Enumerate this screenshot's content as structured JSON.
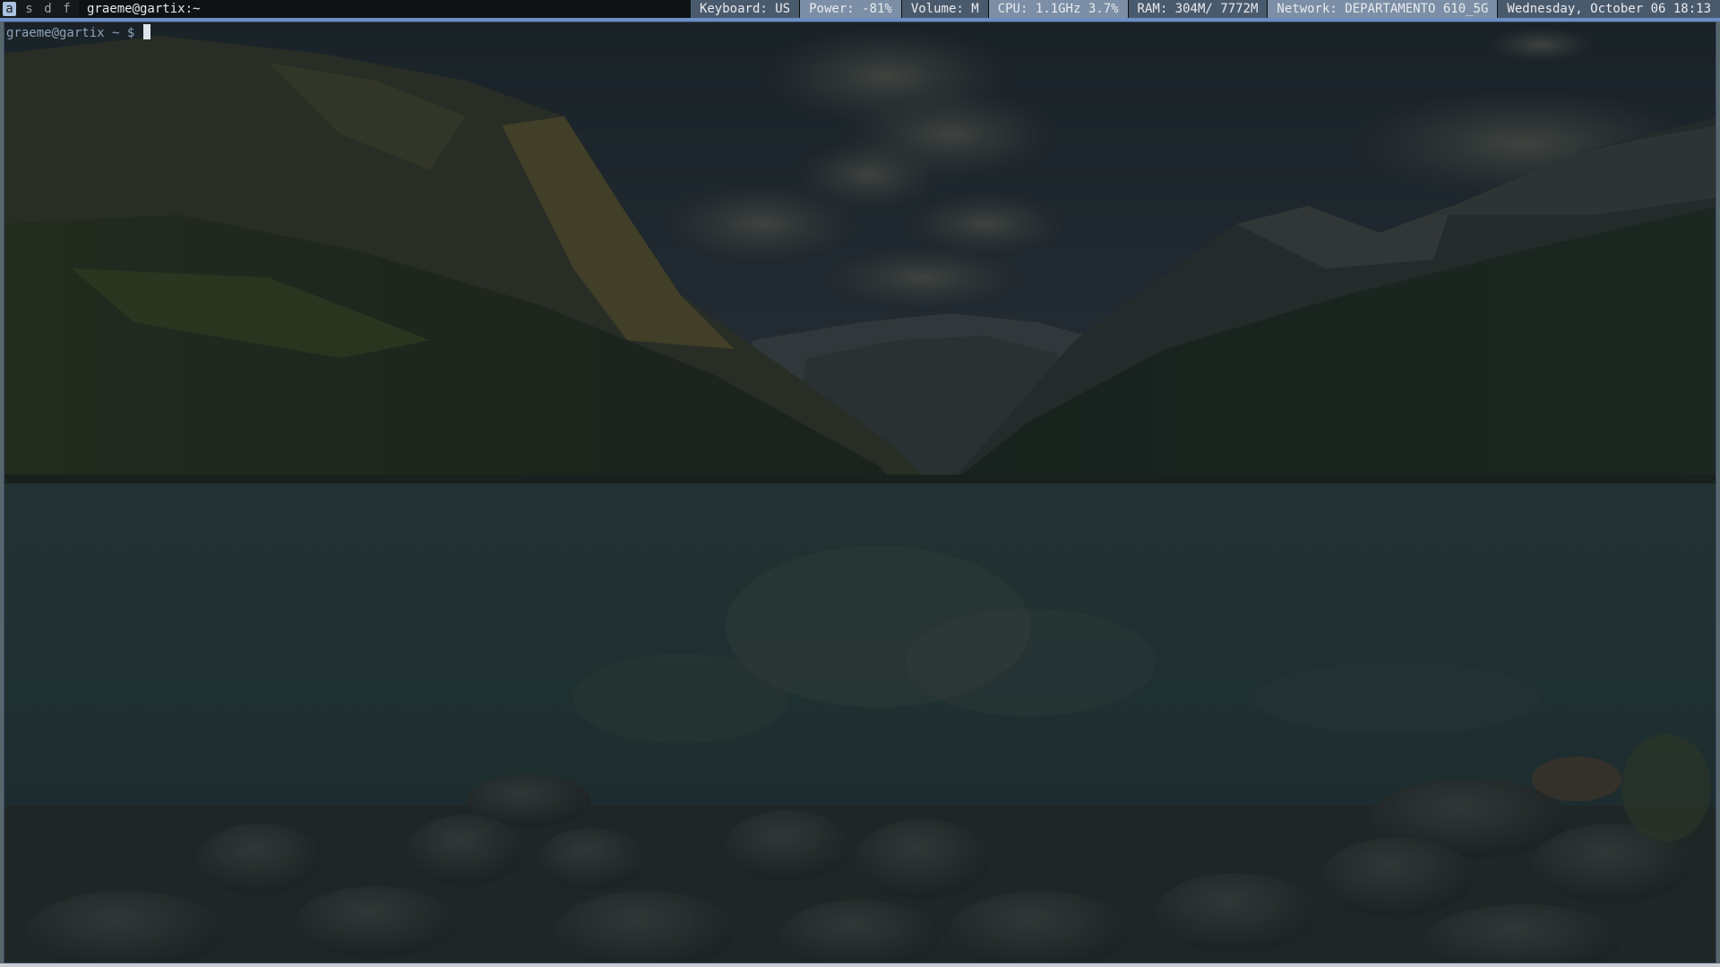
{
  "topbar": {
    "workspaces": [
      {
        "label": "a",
        "active": true
      },
      {
        "label": "s",
        "active": false
      },
      {
        "label": "d",
        "active": false
      },
      {
        "label": "f",
        "active": false
      }
    ],
    "window_title": "graeme@gartix:~",
    "status": {
      "keyboard": "Keyboard: US",
      "power": "Power: -81%",
      "volume": "Volume: M",
      "cpu": "CPU: 1.1GHz 3.7%",
      "ram": "RAM:  304M/ 7772M",
      "network": "Network: DEPARTAMENTO 610_5G",
      "datetime": "Wednesday, October 06 18:13"
    },
    "status_colors": {
      "keyboard": "#4a5a6d",
      "power": "#7c8fa6",
      "volume": "#4a5a6d",
      "cpu": "#7c8fa6",
      "ram": "#4a5a6d",
      "network": "#7c8fa6",
      "datetime": "#4a5a6d"
    },
    "accent": "#6a8ec4"
  },
  "terminal": {
    "prompt": "graeme@gartix ~ $ ",
    "cursor": "block"
  },
  "wallpaper": {
    "description_icon": "mountain-lake-wallpaper"
  }
}
